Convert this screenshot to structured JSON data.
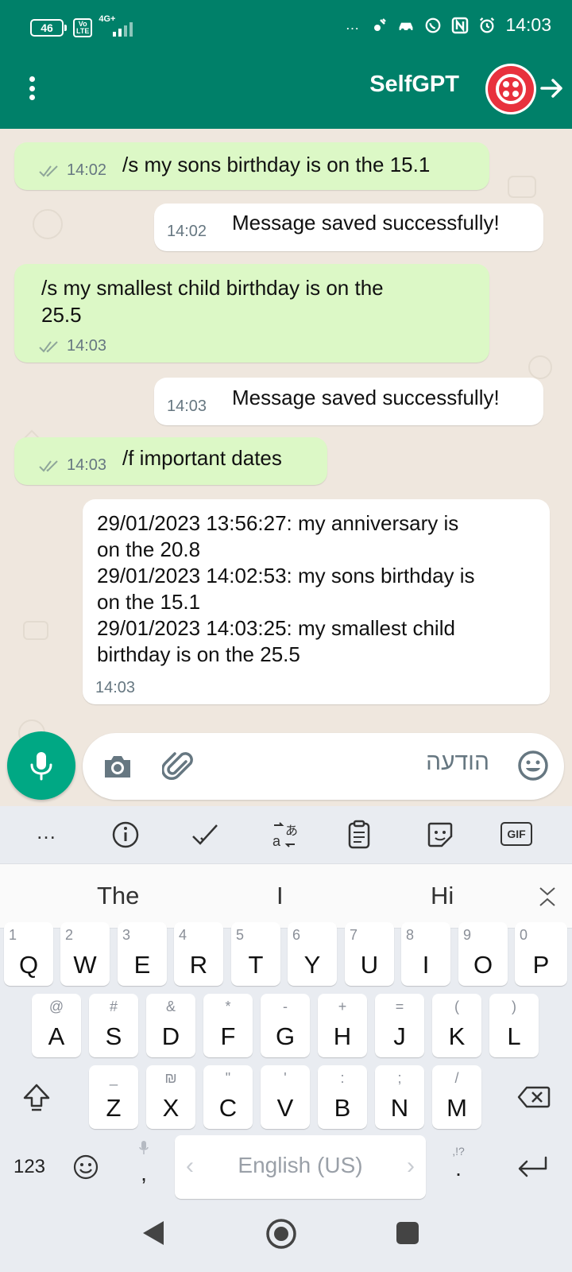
{
  "status_bar": {
    "battery": "46",
    "volte": "Vo\nLTE",
    "network": "4G+",
    "overflow": "…",
    "time": "14:03",
    "icons": [
      "cast-icon",
      "car-icon",
      "whatsapp-icon",
      "nfc-icon",
      "alarm-icon"
    ]
  },
  "header": {
    "title": "SelfGPT",
    "menu_icon": "vertical-dots-icon",
    "avatar_icon": "twilio-logo-icon",
    "action_icon": "arrow-right-icon",
    "colors": {
      "header_bg": "#008069",
      "avatar_bg": "#e8313d"
    }
  },
  "messages": [
    {
      "direction": "out",
      "text": "/s my sons birthday is on the 15.1",
      "time": "14:02",
      "ticks": "double-check-icon"
    },
    {
      "direction": "in",
      "text": "Message saved successfully!",
      "time": "14:02"
    },
    {
      "direction": "out",
      "lines": [
        "/s my smallest child birthday is on the",
        "25.5"
      ],
      "time": "14:03",
      "ticks": "double-check-icon"
    },
    {
      "direction": "in",
      "text": "Message saved successfully!",
      "time": "14:03"
    },
    {
      "direction": "out",
      "text": "/f important dates",
      "time": "14:03",
      "ticks": "double-check-icon"
    },
    {
      "direction": "in",
      "lines": [
        "29/01/2023 13:56:27: my anniversary is",
        "on the 20.8",
        "29/01/2023 14:02:53: my sons birthday is",
        "on the 15.1",
        "29/01/2023 14:03:25: my smallest child",
        "birthday is on the 25.5"
      ],
      "time": "14:03"
    }
  ],
  "composer": {
    "placeholder": "הודעה",
    "icons": [
      "microphone-icon",
      "camera-icon",
      "paperclip-icon",
      "emoji-icon"
    ],
    "colors": {
      "mic_bg": "#00a884",
      "outgoing_bubble": "#dcf8c6"
    }
  },
  "keyboard": {
    "toolbar": [
      "more-icon",
      "info-icon",
      "check-icon",
      "translate-icon",
      "clipboard-icon",
      "sticker-icon",
      "gif-icon"
    ],
    "gif_label": "GIF",
    "more_label": "…",
    "suggestions": [
      "The",
      "I",
      "Hi"
    ],
    "row1": [
      {
        "hint": "1",
        "key": "Q"
      },
      {
        "hint": "2",
        "key": "W"
      },
      {
        "hint": "3",
        "key": "E"
      },
      {
        "hint": "4",
        "key": "R"
      },
      {
        "hint": "5",
        "key": "T"
      },
      {
        "hint": "6",
        "key": "Y"
      },
      {
        "hint": "7",
        "key": "U"
      },
      {
        "hint": "8",
        "key": "I"
      },
      {
        "hint": "9",
        "key": "O"
      },
      {
        "hint": "0",
        "key": "P"
      }
    ],
    "row2": [
      {
        "hint": "@",
        "key": "A"
      },
      {
        "hint": "#",
        "key": "S"
      },
      {
        "hint": "&",
        "key": "D"
      },
      {
        "hint": "*",
        "key": "F"
      },
      {
        "hint": "-",
        "key": "G"
      },
      {
        "hint": "+",
        "key": "H"
      },
      {
        "hint": "=",
        "key": "J"
      },
      {
        "hint": "(",
        "key": "K"
      },
      {
        "hint": ")",
        "key": "L"
      }
    ],
    "row3": [
      {
        "hint": "_",
        "key": "Z"
      },
      {
        "hint": "₪",
        "key": "X"
      },
      {
        "hint": "\"",
        "key": "C"
      },
      {
        "hint": "'",
        "key": "V"
      },
      {
        "hint": ":",
        "key": "B"
      },
      {
        "hint": ";",
        "key": "N"
      },
      {
        "hint": "/",
        "key": "M"
      }
    ],
    "num_key": "123",
    "comma": ",",
    "period_hint": ",!?",
    "period": ".",
    "space": "English (US)"
  },
  "navbar": {
    "icons": [
      "back-icon",
      "home-icon",
      "recents-icon"
    ]
  }
}
